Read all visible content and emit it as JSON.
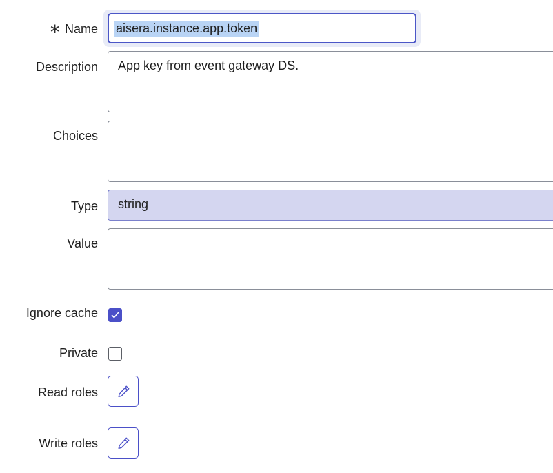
{
  "fields": {
    "name": {
      "label": "Name",
      "required_icon": "asterisk-required-icon",
      "value": "aisera.instance.app.token"
    },
    "description": {
      "label": "Description",
      "value": "App key from event gateway DS."
    },
    "choices": {
      "label": "Choices",
      "value": ""
    },
    "type": {
      "label": "Type",
      "value": "string"
    },
    "value": {
      "label": "Value",
      "value": ""
    },
    "ignore_cache": {
      "label": "Ignore cache",
      "checked": true
    },
    "private": {
      "label": "Private",
      "checked": false
    },
    "read_roles": {
      "label": "Read roles",
      "icon": "pencil-icon"
    },
    "write_roles": {
      "label": "Write roles",
      "icon": "pencil-icon"
    }
  },
  "colors": {
    "accent": "#4b50c8",
    "type_select_bg": "#d4d6f0",
    "selection_highlight": "#b9d4f5"
  }
}
